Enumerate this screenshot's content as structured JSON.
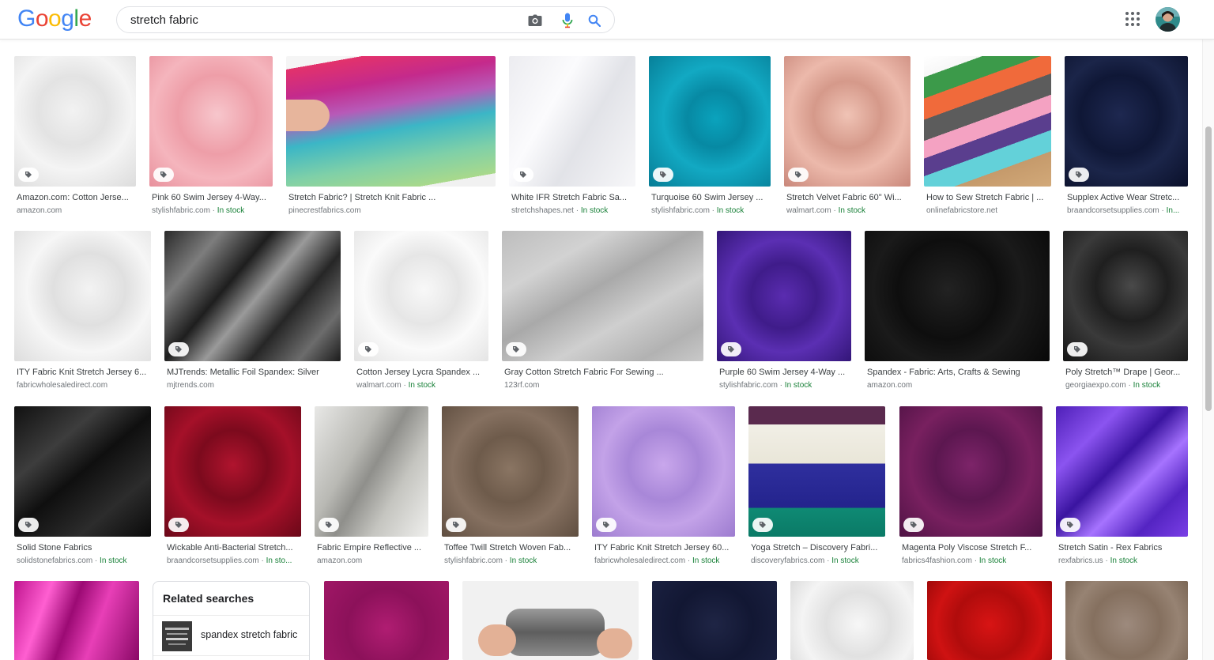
{
  "header": {
    "logo": "Google",
    "search_value": "stretch fabric"
  },
  "results": [
    {
      "title": "Amazon.com: Cotton Jerse...",
      "source": "amazon.com",
      "stock": ""
    },
    {
      "title": "Pink 60 Swim Jersey 4-Way...",
      "source": "stylishfabric.com",
      "stock": "In stock"
    },
    {
      "title": "Stretch Fabric? | Stretch Knit Fabric ...",
      "source": "pinecrestfabrics.com",
      "stock": ""
    },
    {
      "title": "White IFR Stretch Fabric Sa...",
      "source": "stretchshapes.net",
      "stock": "In stock"
    },
    {
      "title": "Turquoise 60 Swim Jersey ...",
      "source": "stylishfabric.com",
      "stock": "In stock"
    },
    {
      "title": "Stretch Velvet Fabric 60\" Wi...",
      "source": "walmart.com",
      "stock": "In stock"
    },
    {
      "title": "How to Sew Stretch Fabric | ...",
      "source": "onlinefabricstore.net",
      "stock": ""
    },
    {
      "title": "Supplex Active Wear Stretc...",
      "source": "braandcorsetsupplies.com",
      "stock": "In..."
    },
    {
      "title": "ITY Fabric Knit Stretch Jersey 6...",
      "source": "fabricwholesaledirect.com",
      "stock": ""
    },
    {
      "title": "MJTrends: Metallic Foil Spandex: Silver",
      "source": "mjtrends.com",
      "stock": ""
    },
    {
      "title": "Cotton Jersey Lycra Spandex ...",
      "source": "walmart.com",
      "stock": "In stock"
    },
    {
      "title": "Gray Cotton Stretch Fabric For Sewing ...",
      "source": "123rf.com",
      "stock": ""
    },
    {
      "title": "Purple 60 Swim Jersey 4-Way ...",
      "source": "stylishfabric.com",
      "stock": "In stock"
    },
    {
      "title": "Spandex - Fabric: Arts, Crafts & Sewing",
      "source": "amazon.com",
      "stock": ""
    },
    {
      "title": "Poly Stretch™ Drape | Geor...",
      "source": "georgiaexpo.com",
      "stock": "In stock"
    },
    {
      "title": "Solid Stone Fabrics",
      "source": "solidstonefabrics.com",
      "stock": "In stock"
    },
    {
      "title": "Wickable Anti-Bacterial Stretch...",
      "source": "braandcorsetsupplies.com",
      "stock": "In sto..."
    },
    {
      "title": "Fabric Empire Reflective ...",
      "source": "amazon.com",
      "stock": ""
    },
    {
      "title": "Toffee Twill Stretch Woven Fab...",
      "source": "stylishfabric.com",
      "stock": "In stock"
    },
    {
      "title": "ITY Fabric Knit Stretch Jersey 60...",
      "source": "fabricwholesaledirect.com",
      "stock": "In stock"
    },
    {
      "title": "Yoga Stretch – Discovery Fabri...",
      "source": "discoveryfabrics.com",
      "stock": "In stock"
    },
    {
      "title": "Magenta Poly Viscose Stretch F...",
      "source": "fabrics4fashion.com",
      "stock": "In stock"
    },
    {
      "title": "Stretch Satin - Rex Fabrics",
      "source": "rexfabrics.us",
      "stock": "In stock"
    }
  ],
  "related": {
    "title": "Related searches",
    "item_label": "spandex stretch fabric"
  },
  "colors": {
    "blue": "#4285F4",
    "red": "#EA4335",
    "yellow": "#FBBC05",
    "green": "#34A853",
    "stock_green": "#188038"
  }
}
